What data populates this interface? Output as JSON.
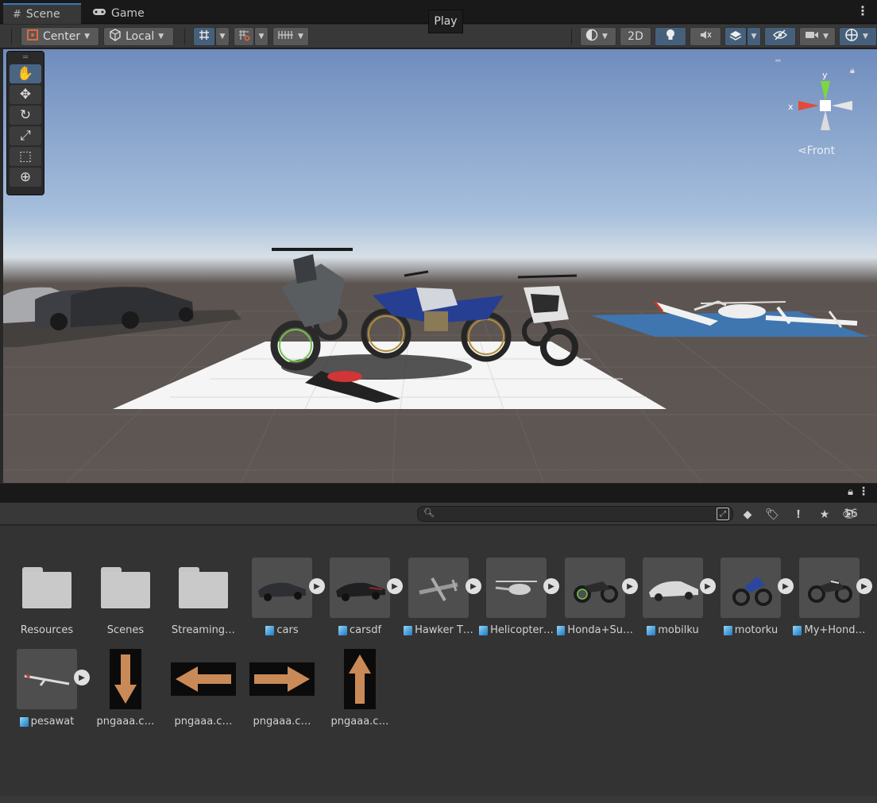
{
  "tabs": [
    {
      "label": "Scene",
      "icon": "grid-icon"
    },
    {
      "label": "Game",
      "icon": "gamepad-icon"
    }
  ],
  "play_tooltip": "Play",
  "toolbar": {
    "pivot_label": "Center",
    "space_label": "Local",
    "mode_2d_label": "2D"
  },
  "scene": {
    "orientation_label": "Front",
    "axis_x": "x",
    "axis_y": "y"
  },
  "project": {
    "search_placeholder": "",
    "hidden_count": "16"
  },
  "assets": [
    {
      "label": "Resources",
      "type": "folder"
    },
    {
      "label": "Scenes",
      "type": "folder"
    },
    {
      "label": "Streaming…",
      "type": "folder"
    },
    {
      "label": "cars",
      "type": "prefab"
    },
    {
      "label": "carsdf",
      "type": "prefab"
    },
    {
      "label": "Hawker T…",
      "type": "prefab"
    },
    {
      "label": "Helicopter…",
      "type": "prefab"
    },
    {
      "label": "Honda+Su…",
      "type": "prefab"
    },
    {
      "label": "mobilku",
      "type": "prefab"
    },
    {
      "label": "motorku",
      "type": "prefab"
    },
    {
      "label": "My+Hond…",
      "type": "prefab"
    },
    {
      "label": "pesawat",
      "type": "prefab"
    },
    {
      "label": "pngaaa.c…",
      "type": "texture",
      "arrow": "down"
    },
    {
      "label": "pngaaa.c…",
      "type": "texture",
      "arrow": "left"
    },
    {
      "label": "pngaaa.c…",
      "type": "texture",
      "arrow": "right"
    },
    {
      "label": "pngaaa.c…",
      "type": "texture",
      "arrow": "up"
    }
  ],
  "colors": {
    "accent_blue": "#46607c",
    "arrow_orange": "#c98a58",
    "prefab_cube": "#4aa3de"
  }
}
